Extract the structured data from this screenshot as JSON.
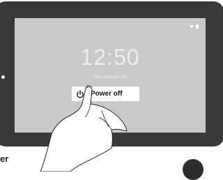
{
  "lock_screen": {
    "time": "12:50",
    "date": "Mon,January18"
  },
  "power_menu": {
    "power_off_label": "Power off",
    "icon": "power-icon"
  },
  "status_bar": {
    "icons": [
      "wifi-icon",
      "battery-icon"
    ]
  },
  "page_text": {
    "bottom_left": "er"
  },
  "colors": {
    "device_frame": "#3a3a3a",
    "screen": "#c9c9c9",
    "button": "#ffffff"
  }
}
